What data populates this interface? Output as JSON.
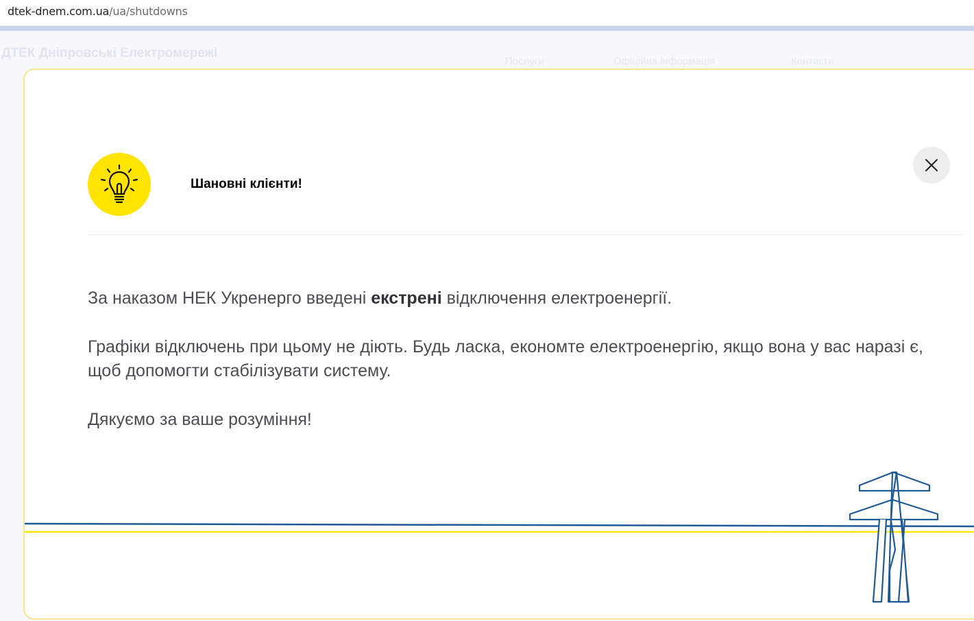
{
  "browser": {
    "url_host": "dtek-dnem.com.ua",
    "url_path": "/ua/shutdowns"
  },
  "background_page": {
    "logo_text": "ДТЕК Дніпровські Електромережі",
    "nav": [
      "Послуги",
      "Офіційна інформація",
      "Контакти"
    ]
  },
  "modal": {
    "title": "Шановні клієнти!",
    "p1_before": "За наказом НЕК Укренерго введені ",
    "p1_bold": "екстрені",
    "p1_after": " відключення електроенергії.",
    "p2": "Графіки відключень при цьому не діють.  Будь ласка, економте електроенергію, якщо вона у вас наразі є, щоб допомогти стабілізувати систему.",
    "p3": "Дякуємо за ваше розуміння!",
    "icons": {
      "badge": "lightbulb-icon",
      "close": "close-icon",
      "decoration": "power-tower-icon"
    }
  },
  "colors": {
    "accent_yellow": "#ffe400",
    "line_blue": "#1f5a96",
    "modal_border": "#f4e88a"
  }
}
